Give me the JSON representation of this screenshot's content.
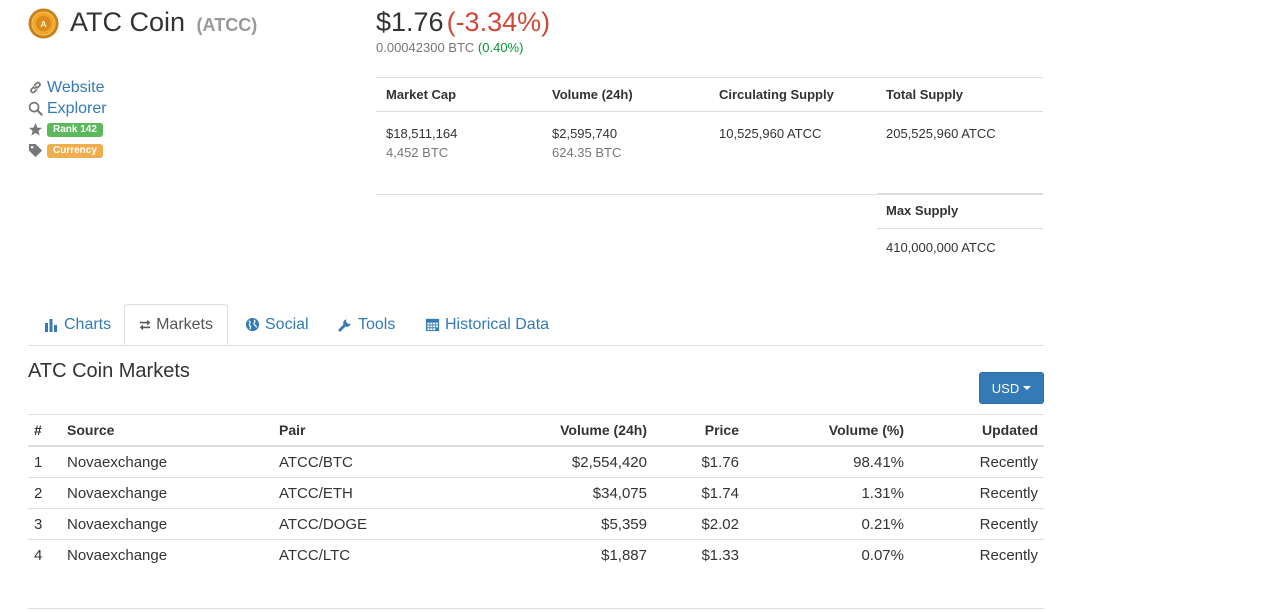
{
  "coin": {
    "name": "ATC Coin",
    "symbol": "(ATCC)",
    "price_usd": "$1.76",
    "price_change": "(-3.34%)",
    "price_btc": "0.00042300 BTC",
    "btc_change": "(0.40%)"
  },
  "links": {
    "website": "Website",
    "explorer": "Explorer",
    "rank": "Rank 142",
    "category": "Currency"
  },
  "stats": {
    "headers": [
      "Market Cap",
      "Volume (24h)",
      "Circulating Supply",
      "Total Supply"
    ],
    "market_cap_usd": "$18,511,164",
    "market_cap_btc": "4,452 BTC",
    "volume_usd": "$2,595,740",
    "volume_btc": "624.35 BTC",
    "circulating_supply": "10,525,960 ATCC",
    "total_supply": "205,525,960 ATCC",
    "max_supply_label": "Max Supply",
    "max_supply": "410,000,000 ATCC"
  },
  "tabs": [
    {
      "label": "Charts",
      "icon": "bar-chart-icon"
    },
    {
      "label": "Markets",
      "icon": "exchange-arrows-icon"
    },
    {
      "label": "Social",
      "icon": "globe-icon"
    },
    {
      "label": "Tools",
      "icon": "wrench-icon"
    },
    {
      "label": "Historical Data",
      "icon": "calendar-icon"
    }
  ],
  "markets": {
    "title": "ATC Coin Markets",
    "currency_button": "USD",
    "columns": [
      "#",
      "Source",
      "Pair",
      "Volume (24h)",
      "Price",
      "Volume (%)",
      "Updated"
    ],
    "rows": [
      {
        "num": "1",
        "source": "Novaexchange",
        "pair": "ATCC/BTC",
        "volume": "$2,554,420",
        "price": "$1.76",
        "volume_pct": "98.41%",
        "updated": "Recently"
      },
      {
        "num": "2",
        "source": "Novaexchange",
        "pair": "ATCC/ETH",
        "volume": "$34,075",
        "price": "$1.74",
        "volume_pct": "1.31%",
        "updated": "Recently"
      },
      {
        "num": "3",
        "source": "Novaexchange",
        "pair": "ATCC/DOGE",
        "volume": "$5,359",
        "price": "$2.02",
        "volume_pct": "0.21%",
        "updated": "Recently"
      },
      {
        "num": "4",
        "source": "Novaexchange",
        "pair": "ATCC/LTC",
        "volume": "$1,887",
        "price": "$1.33",
        "volume_pct": "0.07%",
        "updated": "Recently"
      }
    ]
  },
  "colors": {
    "link": "#337ab7",
    "negative": "#d14836",
    "positive": "#009933",
    "rank_badge": "#5cb85c",
    "category_badge": "#f0ad4e",
    "button": "#337ab7"
  }
}
